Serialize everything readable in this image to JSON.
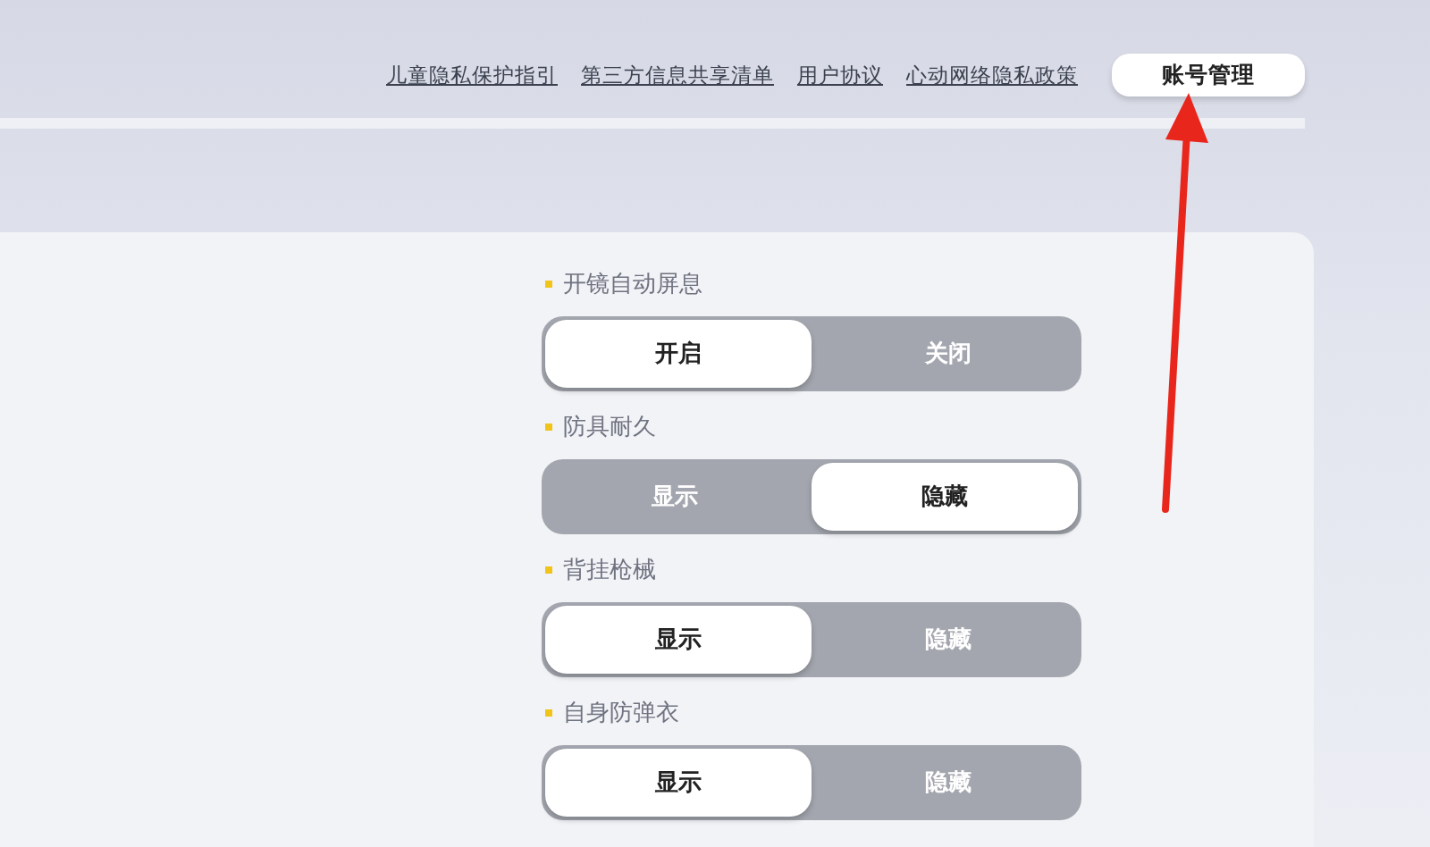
{
  "top_links": [
    {
      "label": "儿童隐私保护指引"
    },
    {
      "label": "第三方信息共享清单"
    },
    {
      "label": "用户协议"
    },
    {
      "label": "心动网络隐私政策"
    }
  ],
  "account_button": {
    "label": "账号管理"
  },
  "settings": [
    {
      "title": "开镜自动屏息",
      "options": [
        {
          "label": "开启",
          "selected": true
        },
        {
          "label": "关闭",
          "selected": false
        }
      ]
    },
    {
      "title": "防具耐久",
      "options": [
        {
          "label": "显示",
          "selected": false
        },
        {
          "label": "隐藏",
          "selected": true
        }
      ]
    },
    {
      "title": "背挂枪械",
      "options": [
        {
          "label": "显示",
          "selected": true
        },
        {
          "label": "隐藏",
          "selected": false
        }
      ]
    },
    {
      "title": "自身防弹衣",
      "options": [
        {
          "label": "显示",
          "selected": true
        },
        {
          "label": "隐藏",
          "selected": false
        }
      ]
    }
  ],
  "annotation": {
    "kind": "arrow"
  }
}
